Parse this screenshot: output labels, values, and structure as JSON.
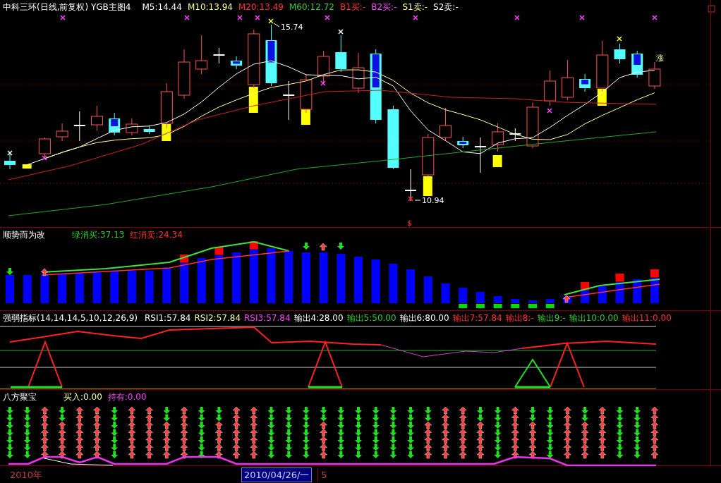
{
  "panels": [
    {
      "kind": "candles",
      "title": "中科三环(日线,前复权) YGB主图4",
      "readings": [
        {
          "text": "M5:14.44",
          "color": "#ffffff"
        },
        {
          "text": "M10:13.94",
          "color": "#ffff99"
        },
        {
          "text": "M20:13.49",
          "color": "#ff3333"
        },
        {
          "text": "M60:12.72",
          "color": "#33cc33"
        },
        {
          "text": "B1买:-",
          "color": "#ff3333"
        },
        {
          "text": "B2买:-",
          "color": "#ff44ff"
        },
        {
          "text": "S1卖:-",
          "color": "#ffff99"
        },
        {
          "text": "S2卖:-",
          "color": "#ffffff"
        }
      ],
      "annotations": [
        {
          "text": "15.74"
        },
        {
          "text": "10.94"
        },
        {
          "text": "涨"
        },
        {
          "text": "$"
        }
      ]
    },
    {
      "kind": "histogram",
      "title": "顺势而为改",
      "readings": [
        {
          "text": "绿消买:37.13",
          "color": "#33cc33"
        },
        {
          "text": "红消卖:24.34",
          "color": "#ff3333"
        }
      ]
    },
    {
      "kind": "oscillator",
      "title": "强弱指标(14,14,14,5,10,12,26,9)",
      "readings": [
        {
          "text": "RSI1:57.84",
          "color": "#ffffff"
        },
        {
          "text": "RSI2:57.84",
          "color": "#ffff99"
        },
        {
          "text": "RSI3:57.84",
          "color": "#ff44ff"
        },
        {
          "text": "输出4:28.00",
          "color": "#ffffff"
        },
        {
          "text": "输出5:50.00",
          "color": "#33cc33"
        },
        {
          "text": "输出6:80.00",
          "color": "#ffffff"
        },
        {
          "text": "输出7:57.84",
          "color": "#ff3333"
        },
        {
          "text": "输出8:-",
          "color": "#ff3333"
        },
        {
          "text": "输出9:-",
          "color": "#33cc33"
        },
        {
          "text": "输出10:0.00",
          "color": "#33cc33"
        },
        {
          "text": "输出11:0.00",
          "color": "#ff3333"
        }
      ]
    },
    {
      "kind": "arrows",
      "title": "八方聚宝",
      "readings": [
        {
          "text": "买入:0.00",
          "color": "#ffff99"
        },
        {
          "text": "持有:0.00",
          "color": "#ff44ff"
        }
      ]
    }
  ],
  "status_bar": {
    "period": "2010年",
    "date": "2010/04/26/一",
    "count": "5"
  }
}
